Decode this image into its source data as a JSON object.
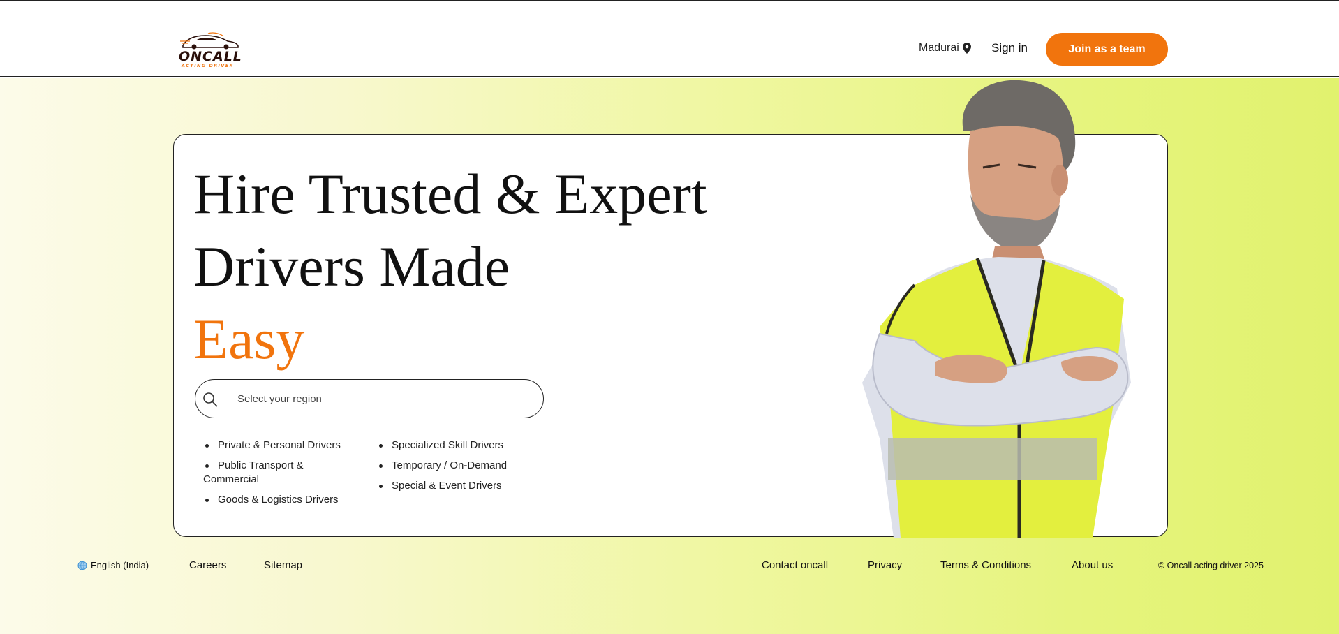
{
  "header": {
    "logo": {
      "word": "ONCALL",
      "tagline": "ACTING DRIVER"
    },
    "location": "Madurai",
    "signin_label": "Sign in",
    "join_label": "Join as a team"
  },
  "hero": {
    "headline_line1": "Hire Trusted & Expert",
    "headline_line2": "Drivers Made",
    "headline_accent": "Easy",
    "search_placeholder": "Select your region",
    "categories_col1": [
      "Private & Personal Drivers",
      "Public Transport & Commercial",
      "Goods & Logistics Drivers"
    ],
    "categories_col2": [
      "Specialized Skill Drivers",
      "Temporary / On-Demand",
      "Special & Event Drivers"
    ]
  },
  "footer": {
    "language": "English (India)",
    "careers": "Careers",
    "sitemap": "Sitemap",
    "contact": "Contact oncall",
    "privacy": "Privacy",
    "terms": "Terms & Conditions",
    "about": "About us",
    "copyright": "© Oncall acting driver 2025"
  },
  "colors": {
    "accent": "#f1740d",
    "gradient_start": "#fcfbe9",
    "gradient_end": "#e1f26e"
  },
  "icons": [
    "location-pin-icon",
    "search-icon",
    "globe-icon"
  ]
}
